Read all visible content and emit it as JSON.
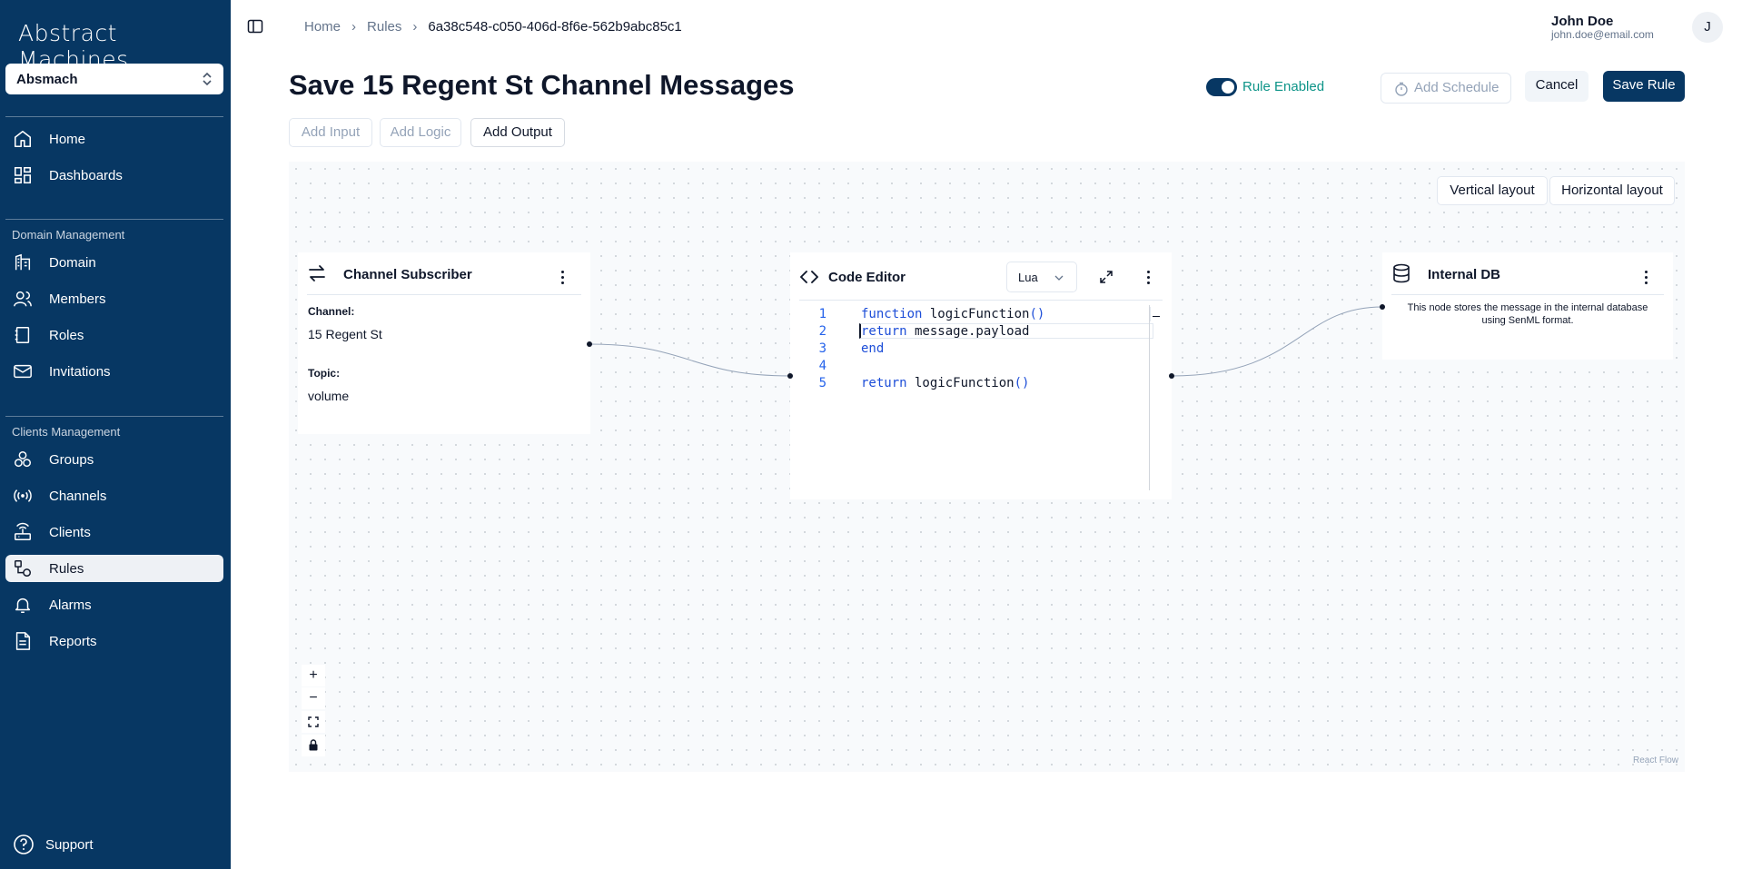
{
  "app": {
    "logo": "Abstract Machines"
  },
  "sidebar": {
    "workspace": "Absmach",
    "items": [
      {
        "label": "Home",
        "icon": "home-icon"
      },
      {
        "label": "Dashboards",
        "icon": "dashboard-icon"
      }
    ],
    "domain_section": "Domain Management",
    "domain_items": [
      {
        "label": "Domain",
        "icon": "domain-icon"
      },
      {
        "label": "Members",
        "icon": "members-icon"
      },
      {
        "label": "Roles",
        "icon": "roles-icon"
      },
      {
        "label": "Invitations",
        "icon": "mail-icon"
      }
    ],
    "clients_section": "Clients Management",
    "clients_items": [
      {
        "label": "Groups",
        "icon": "groups-icon"
      },
      {
        "label": "Channels",
        "icon": "radio-icon"
      },
      {
        "label": "Clients",
        "icon": "router-icon"
      },
      {
        "label": "Rules",
        "icon": "rules-icon",
        "active": true
      },
      {
        "label": "Alarms",
        "icon": "bell-icon"
      },
      {
        "label": "Reports",
        "icon": "report-icon"
      }
    ],
    "support": "Support"
  },
  "breadcrumb": {
    "home": "Home",
    "rules": "Rules",
    "current": "6a38c548-c050-406d-8f6e-562b9abc85c1"
  },
  "user": {
    "name": "John Doe",
    "email": "john.doe@email.com",
    "initial": "J"
  },
  "page": {
    "title": "Save 15 Regent St Channel Messages",
    "rule_enabled_label": "Rule Enabled",
    "rule_enabled": true,
    "add_schedule": "Add Schedule",
    "cancel": "Cancel",
    "save": "Save Rule",
    "add_input": "Add Input",
    "add_logic": "Add Logic",
    "add_output": "Add Output"
  },
  "canvas": {
    "vertical_layout": "Vertical layout",
    "horizontal_layout": "Horizontal layout",
    "watermark": "React Flow",
    "controls": {
      "zoom_in": "+",
      "zoom_out": "−"
    }
  },
  "nodes": {
    "subscriber": {
      "title": "Channel Subscriber",
      "channel_label": "Channel:",
      "channel_value": "15 Regent St",
      "topic_label": "Topic:",
      "topic_value": "volume"
    },
    "editor": {
      "title": "Code Editor",
      "language": "Lua",
      "lines": [
        {
          "n": "1",
          "code": "function logicFunction()"
        },
        {
          "n": "2",
          "code": "  return message.payload"
        },
        {
          "n": "3",
          "code": "end"
        },
        {
          "n": "4",
          "code": ""
        },
        {
          "n": "5",
          "code": "return logicFunction()"
        }
      ]
    },
    "db": {
      "title": "Internal DB",
      "description": "This node stores the message in the internal database using SenML format."
    }
  }
}
